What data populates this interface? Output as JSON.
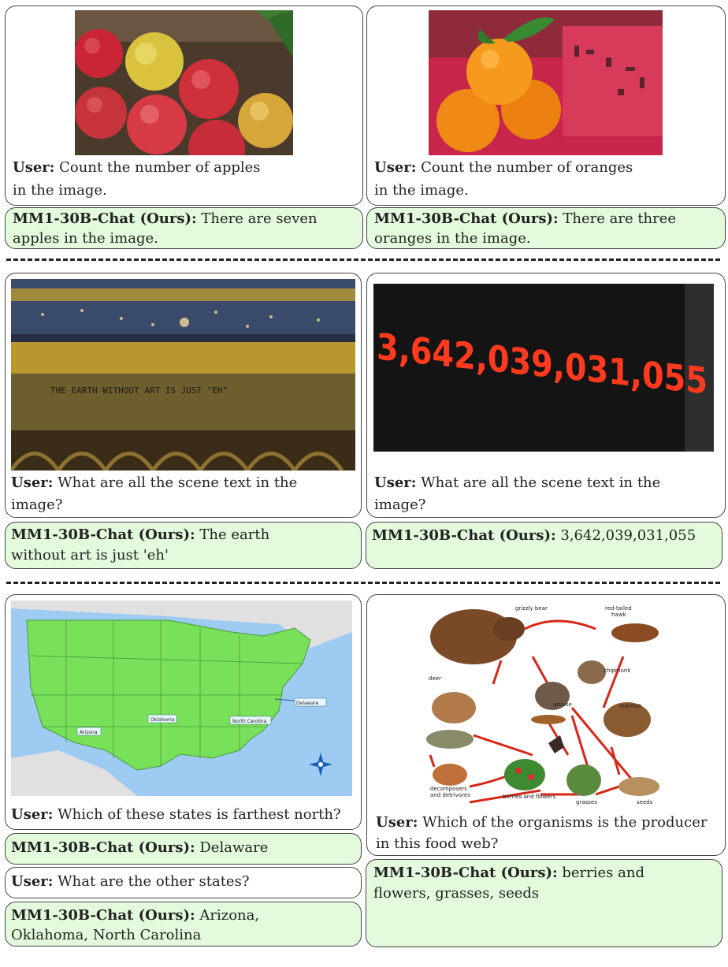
{
  "p1": {
    "user_label": "User:",
    "user_text_l1": "Count the number of apples",
    "user_text_l2": "in the image.",
    "bot_label": "MM1-30B-Chat (Ours):",
    "bot_text_l1": "There are seven",
    "bot_text_l2": "apples in the image."
  },
  "p2": {
    "user_label": "User:",
    "user_text_l1": "Count the number of oranges",
    "user_text_l2": "in the image.",
    "bot_label": "MM1-30B-Chat (Ours):",
    "bot_text_l1": "There are three",
    "bot_text_l2": "oranges in the image."
  },
  "p3": {
    "sign_text": "THE EARTH WITHOUT ART IS JUST \"EH\"",
    "user_label": "User:",
    "user_text_l1": "What are all the scene text in the",
    "user_text_l2": "image?",
    "bot_label": "MM1-30B-Chat (Ours):",
    "bot_text_l1": "The earth",
    "bot_text_l2": "without art is just 'eh'"
  },
  "p4": {
    "ticker_text": "3,642,039,031,055",
    "user_label": "User:",
    "user_text_l1": "What are all the scene text in the",
    "user_text_l2": "image?",
    "bot_label": "MM1-30B-Chat (Ours):",
    "bot_text": "3,642,039,031,055"
  },
  "p5": {
    "map_labels": {
      "delaware": "Delaware",
      "arizona": "Arizona",
      "oklahoma": "Oklahoma",
      "north_carolina": "North Carolina"
    },
    "user_label": "User:",
    "user_text": "Which of these states is farthest north?",
    "bot_label": "MM1-30B-Chat (Ours):",
    "bot_text": "Delaware",
    "user2_label": "User:",
    "user2_text": "What are the other states?",
    "bot2_label": "MM1-30B-Chat (Ours):",
    "bot2_text_l1": "Arizona,",
    "bot2_text_l2": "Oklahoma, North Carolina"
  },
  "p6": {
    "web_labels": {
      "grizzly_bear": "grizzly bear",
      "hawk_l1": "red-tailed",
      "hawk_l2": "hawk",
      "chipmunk": "chipmunk",
      "deer": "deer",
      "grouse": "grouse",
      "marmot": "marmot",
      "decomposers_l1": "decomposers",
      "decomposers_l2": "and detrivores",
      "berries": "berries and flowers",
      "grasses": "grasses",
      "seeds": "seeds"
    },
    "user_label": "User:",
    "user_text_l1": "Which of the organisms is the producer",
    "user_text_l2": "in this food web?",
    "bot_label": "MM1-30B-Chat (Ours):",
    "bot_text_l1": "berries and",
    "bot_text_l2": "flowers, grasses, seeds"
  }
}
